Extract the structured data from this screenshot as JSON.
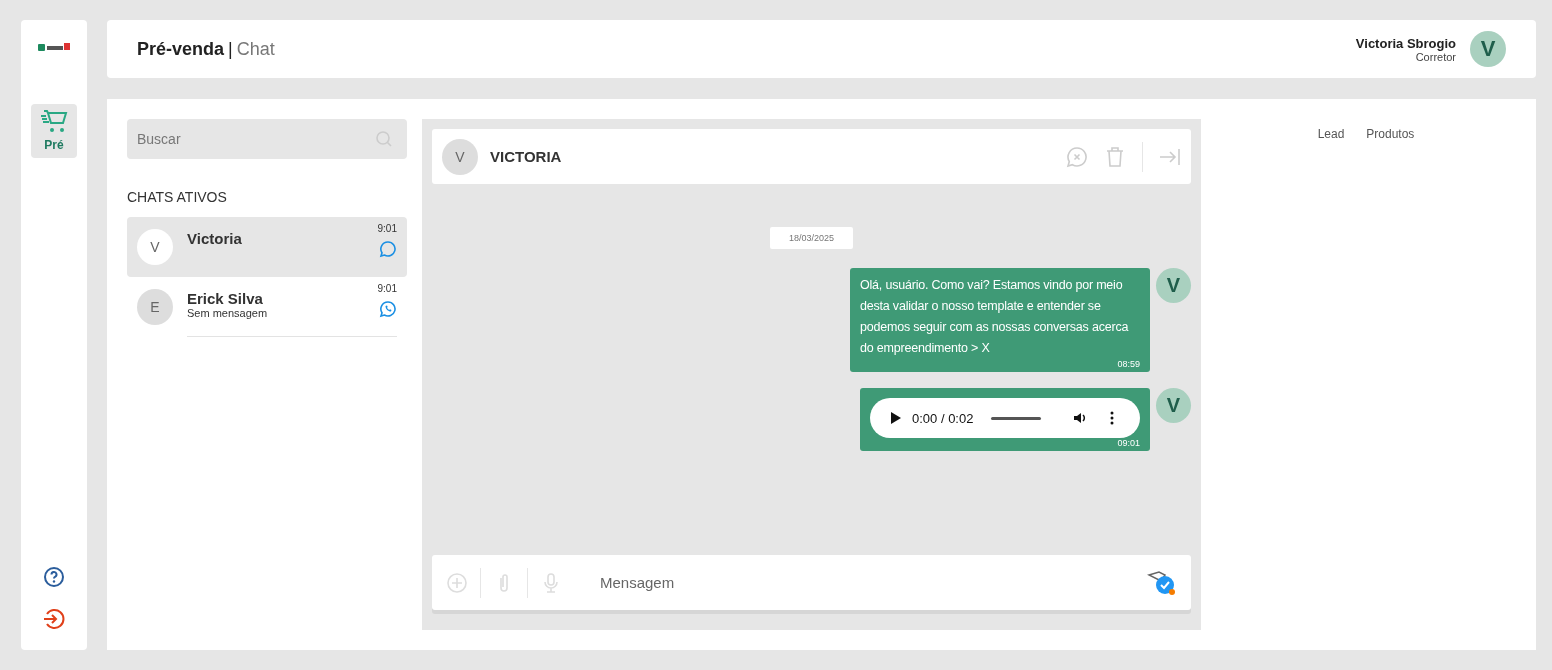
{
  "sidebar": {
    "items": [
      {
        "label": "Pré",
        "selected": true
      }
    ]
  },
  "header": {
    "title": "Pré-venda",
    "separator": "|",
    "subtitle": "Chat",
    "user": {
      "name": "Victoria Sbrogio",
      "role": "Corretor",
      "initial": "V"
    }
  },
  "chat_list": {
    "search": {
      "placeholder": "Buscar"
    },
    "section_title": "CHATS ATIVOS",
    "chats": [
      {
        "initial": "V",
        "name": "Victoria",
        "time": "9:01",
        "kind": "chat",
        "selected": true
      },
      {
        "initial": "E",
        "name": "Erick Silva",
        "preview": "Sem mensagem",
        "time": "9:01",
        "kind": "whatsapp",
        "selected": false
      }
    ]
  },
  "conversation": {
    "contact": {
      "initial": "V",
      "name": "VICTORIA"
    },
    "date": "18/03/2025",
    "messages": [
      {
        "kind": "text",
        "text": "Olá, usuário. Como vai? Estamos vindo por meio desta validar o nosso template e entender se podemos seguir com as nossas conversas acerca do empreendimento > X",
        "time": "08:59",
        "avatar": "V"
      },
      {
        "kind": "audio",
        "player_time": "0:00 / 0:02",
        "time": "09:01",
        "avatar": "V"
      }
    ],
    "composer": {
      "placeholder": "Mensagem"
    }
  },
  "details": {
    "tabs": [
      {
        "label": "Lead",
        "selected": false
      },
      {
        "label": "Produtos",
        "selected": false
      }
    ]
  }
}
